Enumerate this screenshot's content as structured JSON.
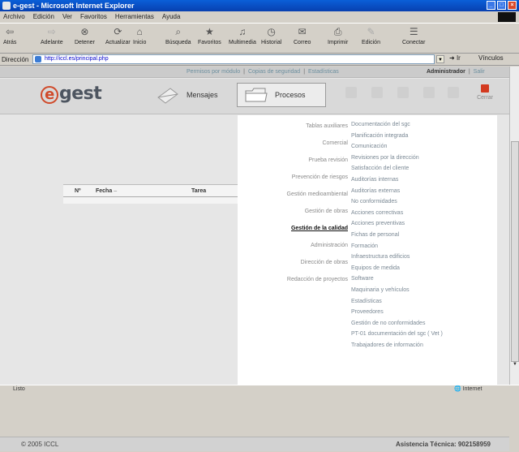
{
  "window": {
    "title": "e-gest - Microsoft Internet Explorer",
    "controls": [
      "_",
      "□",
      "×"
    ]
  },
  "ie_menu": [
    "Archivo",
    "Edición",
    "Ver",
    "Favoritos",
    "Herramientas",
    "Ayuda"
  ],
  "ie_toolbar": [
    {
      "label": "Atrás",
      "icon": "back-arrow-icon",
      "glyph": "⇦"
    },
    {
      "label": "Adelante",
      "icon": "forward-arrow-icon",
      "glyph": "⇨"
    },
    {
      "label": "Detener",
      "icon": "stop-icon",
      "glyph": "⊗"
    },
    {
      "label": "Actualizar",
      "icon": "refresh-icon",
      "glyph": "⟳"
    },
    {
      "label": "Inicio",
      "icon": "home-icon",
      "glyph": "⌂"
    },
    {
      "label": "Búsqueda",
      "icon": "search-icon",
      "glyph": "⌕"
    },
    {
      "label": "Favoritos",
      "icon": "favorites-icon",
      "glyph": "★"
    },
    {
      "label": "Multimedia",
      "icon": "media-icon",
      "glyph": "♫"
    },
    {
      "label": "Historial",
      "icon": "history-icon",
      "glyph": "◷"
    },
    {
      "label": "Correo",
      "icon": "mail-icon",
      "glyph": "✉"
    },
    {
      "label": "Imprimir",
      "icon": "print-icon",
      "glyph": "⎙"
    },
    {
      "label": "Edición",
      "icon": "edit-icon",
      "glyph": "✎"
    },
    {
      "label": "Conectar",
      "icon": "discuss-icon",
      "glyph": "☰"
    }
  ],
  "address": {
    "label": "Dirección",
    "value": "http://iccl.es/principal.php",
    "go": "Ir",
    "links": "Vínculos"
  },
  "top_nav": {
    "links": [
      "Permisos por módulo",
      "Copias de seguridad",
      "Estadísticas"
    ],
    "user": "Administrador",
    "logout": "Salir"
  },
  "header": {
    "logo_e": "e",
    "logo_rest": "gest",
    "mensajes": "Mensajes",
    "procesos": "Procesos",
    "cerrar": "Cerrar"
  },
  "table": {
    "col_no": "Nº",
    "col_fecha": "Fecha",
    "col_tarea": "Tarea",
    "sort_icon": "sort-arrow-icon"
  },
  "menu": {
    "left": [
      {
        "label": "Tablas auxiliares",
        "selected": false
      },
      {
        "label": "Comercial",
        "selected": false
      },
      {
        "label": "Prueba revisión",
        "selected": false
      },
      {
        "label": "Prevención de riesgos",
        "selected": false
      },
      {
        "label": "Gestión medioambiental",
        "selected": false
      },
      {
        "label": "Gestión de obras",
        "selected": false
      },
      {
        "label": "Gestión de la calidad",
        "selected": true
      },
      {
        "label": "Administración",
        "selected": false
      },
      {
        "label": "Dirección de obras",
        "selected": false
      },
      {
        "label": "Redacción de proyectos",
        "selected": false
      }
    ],
    "right": [
      "Documentación del sgc",
      "Planificación integrada",
      "Comunicación",
      "Revisiones por la dirección",
      "Satisfacción del cliente",
      "Auditorías internas",
      "Auditorías externas",
      "No conformidades",
      "Acciones correctivas",
      "Acciones preventivas",
      "Fichas de personal",
      "Formación",
      "Infraestructura edificios",
      "Equipos de medida",
      "Software",
      "Maquinaria y vehículos",
      "Estadísticas",
      "Proveedores",
      "Gestión de no conformidades",
      "PT-01 documentación del sgc ( Vet )",
      "Trabajadores de información"
    ]
  },
  "status": {
    "copyright": "© 2005 ICCL",
    "support": "Asistencia Técnica: 902158959"
  },
  "ie_status": {
    "text": "Listo",
    "zone": "Internet"
  },
  "colors": {
    "title_bar": "#0a5fd8",
    "logo_accent": "#d04a2a",
    "link_muted": "#6c8f9f"
  }
}
